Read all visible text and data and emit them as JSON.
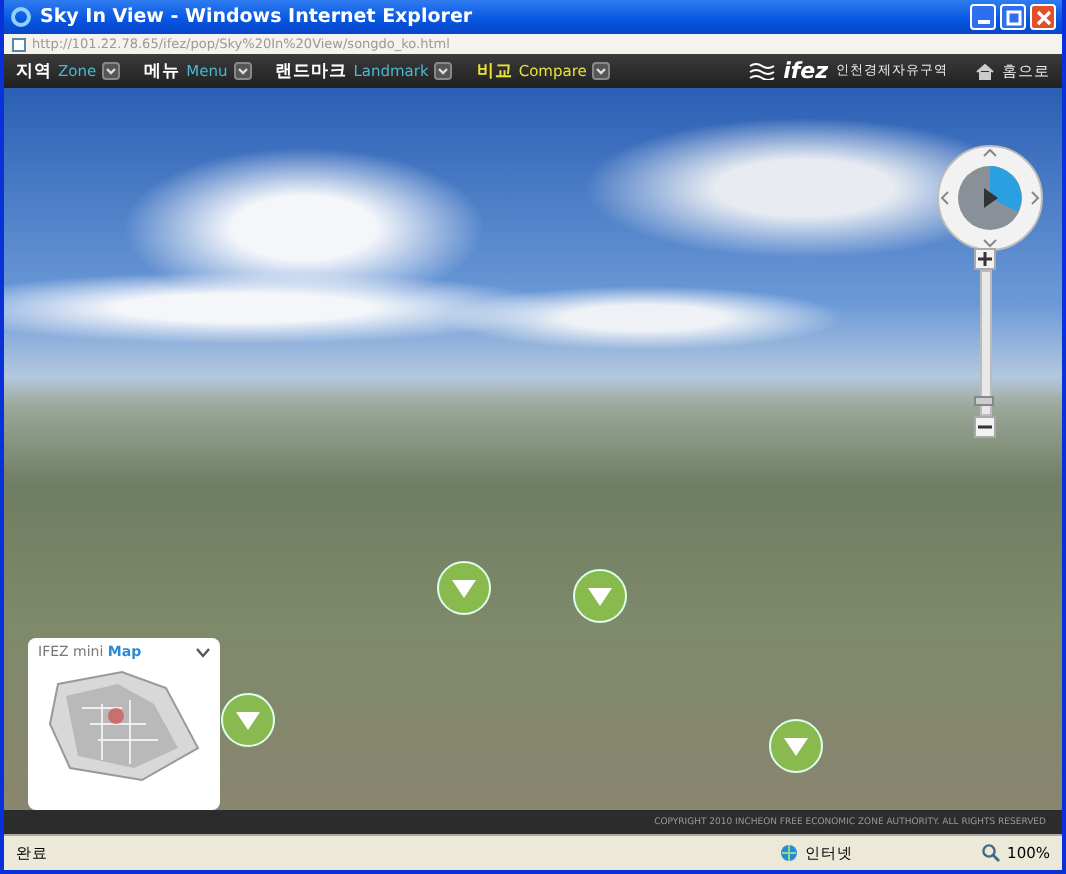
{
  "window": {
    "title": "Sky In View - Windows Internet Explorer"
  },
  "address_bar": {
    "url": "http://101.22.78.65/ifez/pop/Sky%20In%20View/songdo_ko.html"
  },
  "nav_menu": [
    {
      "label": "지역",
      "sublabel": "Zone",
      "selected": false
    },
    {
      "label": "메뉴",
      "sublabel": "Menu",
      "selected": false
    },
    {
      "label": "랜드마크",
      "sublabel": "Landmark",
      "selected": false
    },
    {
      "label": "비교",
      "sublabel": "Compare",
      "selected": true
    }
  ],
  "brand": {
    "logo": "ifez",
    "tagline": "인천경제자유구역"
  },
  "home_link": "홈으로",
  "zoom": {
    "level": 0.05
  },
  "minimap": {
    "title": "IFEZ mini",
    "title_accent": "Map"
  },
  "footer": {
    "copyright": "COPYRIGHT 2010 INCHEON FREE ECONOMIC ZONE AUTHORITY. ALL RIGHTS RESERVED"
  },
  "status_bar": {
    "status": "완료",
    "zone": "인터넷",
    "zoom": "100%"
  }
}
